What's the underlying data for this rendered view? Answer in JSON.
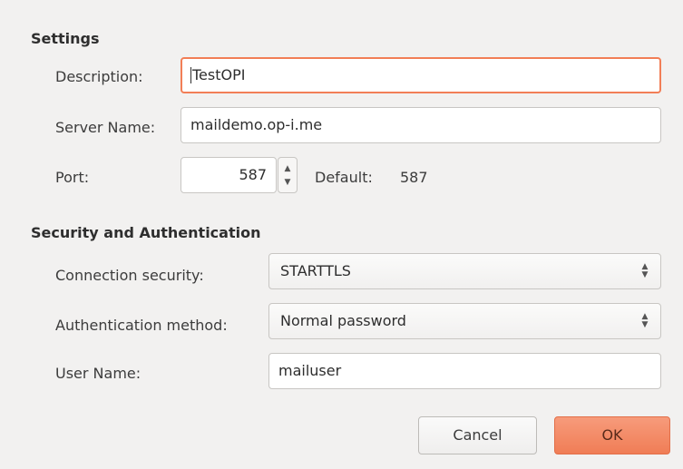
{
  "settings": {
    "title": "Settings",
    "description_label": "Description:",
    "description_value": "TestOPI",
    "server_label": "Server Name:",
    "server_value": "maildemo.op-i.me",
    "port_label": "Port:",
    "port_value": "587",
    "default_label": "Default:",
    "default_value": "587"
  },
  "security": {
    "title": "Security and Authentication",
    "connection_label": "Connection security:",
    "connection_value": "STARTTLS",
    "auth_label": "Authentication method:",
    "auth_value": "Normal password",
    "username_label": "User Name:",
    "username_value": "mailuser"
  },
  "buttons": {
    "cancel": "Cancel",
    "ok": "OK"
  },
  "colors": {
    "accent": "#f27e56",
    "background": "#f2f1f0"
  },
  "icons": {
    "spin_up": "chevron-up-icon",
    "spin_down": "chevron-down-icon",
    "select_updown": "updown-arrows-icon"
  }
}
